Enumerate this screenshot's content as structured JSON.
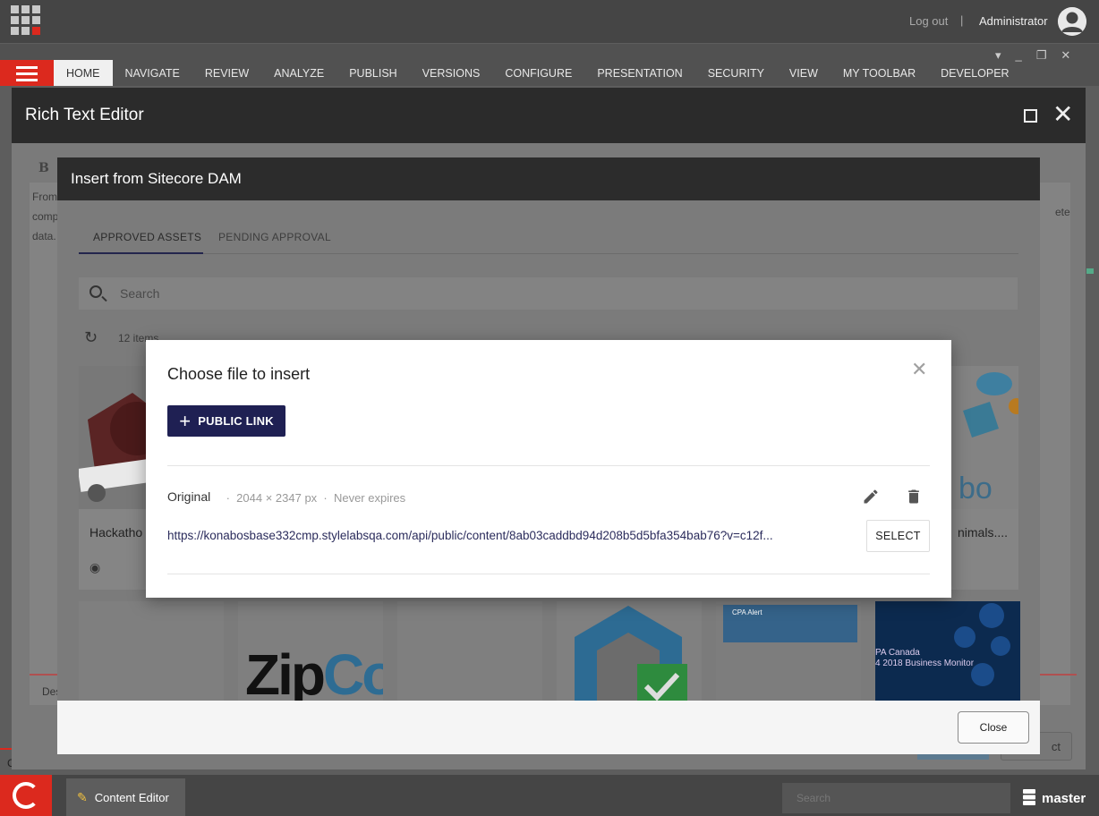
{
  "header": {
    "logout_label": "Log out",
    "separator": "|",
    "username": "Administrator"
  },
  "ribbon": {
    "tabs": [
      "HOME",
      "NAVIGATE",
      "REVIEW",
      "ANALYZE",
      "PUBLISH",
      "VERSIONS",
      "CONFIGURE",
      "PRESENTATION",
      "SECURITY",
      "VIEW",
      "MY TOOLBAR",
      "DEVELOPER"
    ],
    "active_tab": "HOME"
  },
  "rich_text_editor": {
    "title": "Rich Text Editor",
    "bold_label": "B",
    "content_lines": [
      "From",
      "comp",
      "data."
    ],
    "content_tail": "ete",
    "footer_text": "Des",
    "right_button_tail": "ct"
  },
  "dam": {
    "title": "Insert from Sitecore DAM",
    "tabs": {
      "approved": "APPROVED ASSETS",
      "pending": "PENDING APPROVAL"
    },
    "search": {
      "placeholder": "Search"
    },
    "count": "12 items",
    "cards": [
      {
        "label": "Hackatho"
      },
      {
        "label": "nimals....",
        "image_text": "bo"
      }
    ],
    "tiles": {
      "zip_text_a": "Zip",
      "zip_text_b": "Co",
      "cpa_alert": "CPA Alert",
      "cpa_canada_line1": "PA Canada",
      "cpa_canada_line2": "4 2018 Business Monitor"
    },
    "close_label": "Close"
  },
  "modal": {
    "title": "Choose file to insert",
    "public_link_label": "PUBLIC LINK",
    "original_label": "Original",
    "dimensions": "2044 × 2347 px",
    "expiry": "Never expires",
    "url": "https://konabosbase332cmp.stylelabsqa.com/api/public/content/8ab03caddbd94d208b5d5bfa354bab76?v=c12f...",
    "select_label": "SELECT"
  },
  "taskbar": {
    "content_editor_label": "Content Editor",
    "search_placeholder": "Search",
    "database_label": "master",
    "left_fragment": "C"
  },
  "colors": {
    "brand_red": "#dc291e",
    "primary_navy": "#1f2053",
    "header_dark": "#2c2c2c"
  }
}
